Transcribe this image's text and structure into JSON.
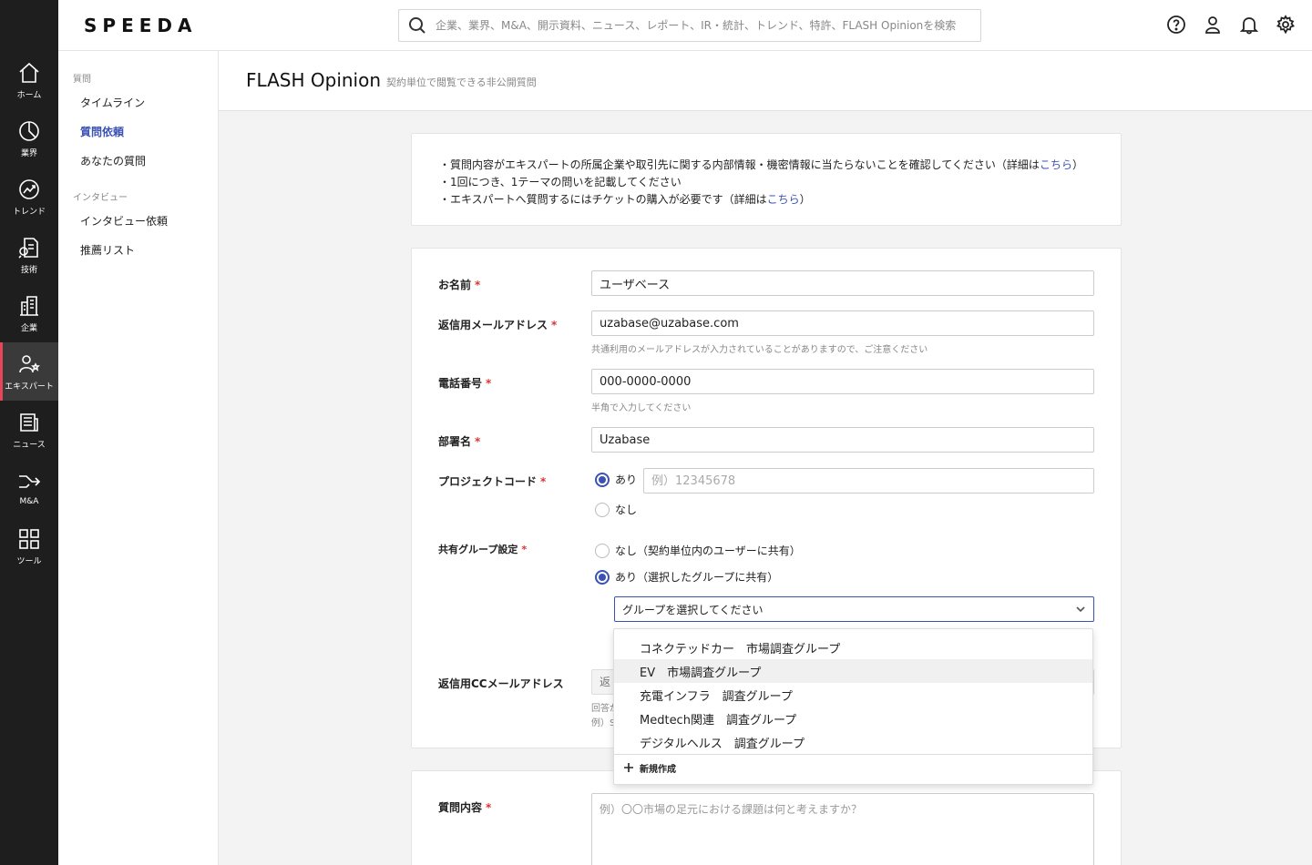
{
  "app": {
    "logo": "SPEEDA"
  },
  "search": {
    "placeholder": "企業、業界、M&A、開示資料、ニュース、レポート、IR・統計、トレンド、特許、FLASH Opinionを検索"
  },
  "header_icons": [
    "help-icon",
    "user-icon",
    "bell-icon",
    "gear-icon"
  ],
  "rail": {
    "items": [
      {
        "label": "ホーム",
        "icon": "home-icon"
      },
      {
        "label": "業界",
        "icon": "pie-chart-icon"
      },
      {
        "label": "トレンド",
        "icon": "trend-icon"
      },
      {
        "label": "技術",
        "icon": "tech-icon"
      },
      {
        "label": "企業",
        "icon": "building-icon"
      },
      {
        "label": "エキスパート",
        "icon": "expert-icon"
      },
      {
        "label": "ニュース",
        "icon": "news-icon"
      },
      {
        "label": "M&A",
        "icon": "merge-icon"
      },
      {
        "label": "ツール",
        "icon": "grid-icon"
      }
    ],
    "active": "エキスパート"
  },
  "subnav": {
    "group1": "質問",
    "item_timeline": "タイムライン",
    "item_request": "質問依頼",
    "item_yours": "あなたの質問",
    "group2": "インタビュー",
    "item_interview": "インタビュー依頼",
    "item_recommend": "推薦リスト"
  },
  "page": {
    "title": "FLASH Opinion",
    "subtitle": "契約単位で閲覧できる非公開質問"
  },
  "notice": {
    "line1_pre": "・質問内容がエキスパートの所属企業や取引先に関する内部情報・機密情報に当たらないことを確認してください（詳細は",
    "line1_link": "こちら",
    "line1_post": "）",
    "line2": "・1回につき、1テーマの問いを記載してください",
    "line3_pre": "・エキスパートへ質問するにはチケットの購入が必要です（詳細は",
    "line3_link": "こちら",
    "line3_post": "）"
  },
  "form": {
    "required_mark": "*",
    "name_label": "お名前",
    "name_value": "ユーザベース",
    "email_label": "返信用メールアドレス",
    "email_value": "uzabase@uzabase.com",
    "email_hint": "共通利用のメールアドレスが入力されていることがありますので、ご注意ください",
    "phone_label": "電話番号",
    "phone_value": "000-0000-0000",
    "phone_hint": "半角で入力してください",
    "dept_label": "部署名",
    "dept_value": "Uzabase",
    "project_label": "プロジェクトコード",
    "project_yes": "あり",
    "project_placeholder": "例）12345678",
    "project_no": "なし",
    "share_label": "共有グループ設定",
    "share_no": "なし（契約単位内のユーザーに共有）",
    "share_yes": "あり（選択したグループに共有）",
    "share_select": "グループを選択してください",
    "cc_label": "返信用CCメールアドレス",
    "cc_placeholder": "返",
    "cc_hint1": "回答が",
    "cc_hint2": "例）S"
  },
  "dropdown": {
    "options": [
      "コネクテッドカー　市場調査グループ",
      "EV　市場調査グループ",
      "充電インフラ　調査グループ",
      "Medtech関連　調査グループ",
      "デジタルヘルス　調査グループ"
    ],
    "highlighted_index": 1,
    "new_label": "新規作成"
  },
  "question": {
    "label": "質問内容",
    "placeholder": "例）〇〇市場の足元における課題は何と考えますか？"
  },
  "colors": {
    "accent": "#3a52b4",
    "rail_bg": "#1e1e1e",
    "active_marker": "#e8455a",
    "required": "#dd3333"
  }
}
